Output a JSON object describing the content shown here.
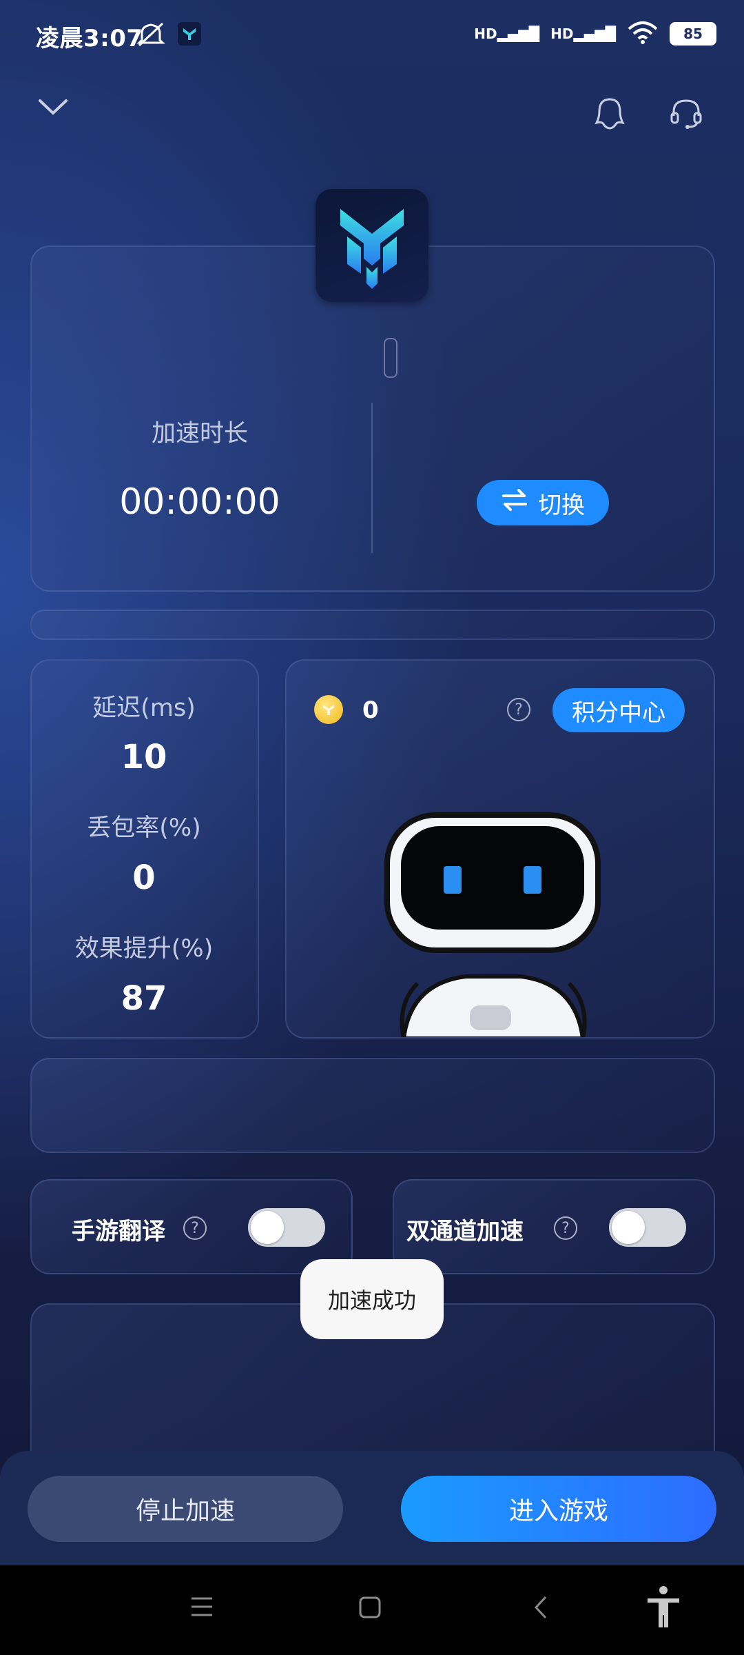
{
  "status_bar": {
    "time": "凌晨3:07",
    "battery": "85"
  },
  "header": {
    "collapse_icon": "chevron-down-icon",
    "qq_icon": "qq-icon",
    "support_icon": "headset-icon"
  },
  "accel": {
    "duration_label": "加速时长",
    "duration_value": "00:00:00",
    "switch_label": "切换"
  },
  "stats": {
    "latency_label": "延迟(ms)",
    "latency_value": "10",
    "loss_label": "丢包率(%)",
    "loss_value": "0",
    "boost_label": "效果提升(%)",
    "boost_value": "87"
  },
  "points": {
    "count": "0",
    "center_label": "积分中心"
  },
  "toggles": {
    "translate_label": "手游翻译",
    "translate_on": false,
    "dual_label": "双通道加速",
    "dual_on": false
  },
  "toast": {
    "text": "加速成功"
  },
  "actions": {
    "stop_label": "停止加速",
    "enter_label": "进入游戏"
  },
  "colors": {
    "accent": "#1e8cff",
    "bg": "#1a2a5c"
  }
}
